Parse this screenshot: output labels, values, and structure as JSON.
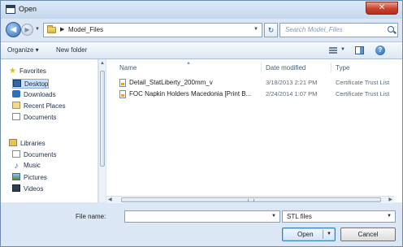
{
  "window": {
    "title": "Open"
  },
  "address_bar": {
    "path": "Model_Files"
  },
  "search": {
    "placeholder": "Search Model_Files"
  },
  "toolbar": {
    "organize_label": "Organize ▾",
    "new_folder_label": "New folder"
  },
  "nav_pane": {
    "favorites_label": "Favorites",
    "favorites": [
      "Desktop",
      "Downloads",
      "Recent Places",
      "Documents"
    ],
    "libraries_label": "Libraries",
    "libraries": [
      "Documents",
      "Music",
      "Pictures",
      "Videos"
    ]
  },
  "file_list": {
    "columns": [
      "Name",
      "Date modified",
      "Type"
    ],
    "rows": [
      {
        "name": "Detail_StatLiberty_200mm_v",
        "date": "3/18/2013 2:21 PM",
        "type": "Certificate Trust List"
      },
      {
        "name": "FOC Napkin Holders Macedonia [Print B...",
        "date": "2/24/2014 1:07 PM",
        "type": "Certificate Trust List"
      }
    ]
  },
  "file_name": {
    "label": "File name:",
    "value": ""
  },
  "file_type_filter": {
    "selected": "STL files"
  },
  "buttons": {
    "open": "Open",
    "cancel": "Cancel"
  },
  "colors": {
    "window_bg": "#dbe7f4",
    "close_button": "#c8412b",
    "selection_bg": "#cde1f8"
  },
  "icons": [
    "app-icon",
    "back-icon",
    "forward-icon",
    "folder-icon",
    "refresh-icon",
    "search-icon",
    "view-icon",
    "preview-pane-icon",
    "help-icon",
    "star-icon",
    "desktop-icon",
    "downloads-icon",
    "recent-places-icon",
    "documents-icon",
    "libraries-icon",
    "music-icon",
    "pictures-icon",
    "videos-icon",
    "stl-file-icon"
  ]
}
